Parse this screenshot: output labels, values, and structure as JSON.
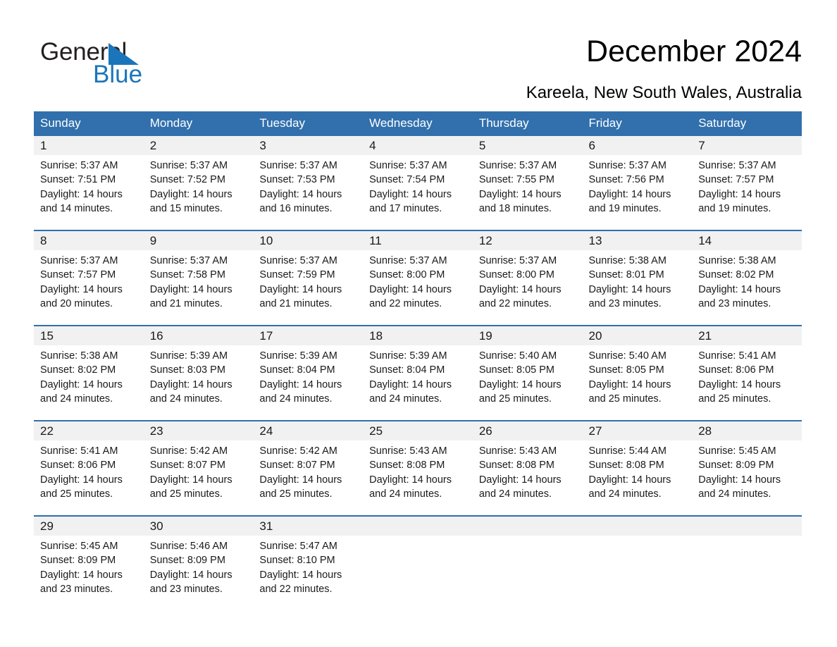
{
  "brand": {
    "name_part1": "General",
    "name_part2": "Blue",
    "triangle_color": "#1b75bb",
    "text_color": "#231f20"
  },
  "header": {
    "title": "December 2024",
    "subtitle": "Kareela, New South Wales, Australia",
    "header_bg": "#3170ad",
    "daynum_bg": "#f1f1f1"
  },
  "weekdays": [
    "Sunday",
    "Monday",
    "Tuesday",
    "Wednesday",
    "Thursday",
    "Friday",
    "Saturday"
  ],
  "weeks": [
    {
      "days": [
        {
          "num": "1",
          "sunrise": "Sunrise: 5:37 AM",
          "sunset": "Sunset: 7:51 PM",
          "daylight1": "Daylight: 14 hours",
          "daylight2": "and 14 minutes."
        },
        {
          "num": "2",
          "sunrise": "Sunrise: 5:37 AM",
          "sunset": "Sunset: 7:52 PM",
          "daylight1": "Daylight: 14 hours",
          "daylight2": "and 15 minutes."
        },
        {
          "num": "3",
          "sunrise": "Sunrise: 5:37 AM",
          "sunset": "Sunset: 7:53 PM",
          "daylight1": "Daylight: 14 hours",
          "daylight2": "and 16 minutes."
        },
        {
          "num": "4",
          "sunrise": "Sunrise: 5:37 AM",
          "sunset": "Sunset: 7:54 PM",
          "daylight1": "Daylight: 14 hours",
          "daylight2": "and 17 minutes."
        },
        {
          "num": "5",
          "sunrise": "Sunrise: 5:37 AM",
          "sunset": "Sunset: 7:55 PM",
          "daylight1": "Daylight: 14 hours",
          "daylight2": "and 18 minutes."
        },
        {
          "num": "6",
          "sunrise": "Sunrise: 5:37 AM",
          "sunset": "Sunset: 7:56 PM",
          "daylight1": "Daylight: 14 hours",
          "daylight2": "and 19 minutes."
        },
        {
          "num": "7",
          "sunrise": "Sunrise: 5:37 AM",
          "sunset": "Sunset: 7:57 PM",
          "daylight1": "Daylight: 14 hours",
          "daylight2": "and 19 minutes."
        }
      ]
    },
    {
      "days": [
        {
          "num": "8",
          "sunrise": "Sunrise: 5:37 AM",
          "sunset": "Sunset: 7:57 PM",
          "daylight1": "Daylight: 14 hours",
          "daylight2": "and 20 minutes."
        },
        {
          "num": "9",
          "sunrise": "Sunrise: 5:37 AM",
          "sunset": "Sunset: 7:58 PM",
          "daylight1": "Daylight: 14 hours",
          "daylight2": "and 21 minutes."
        },
        {
          "num": "10",
          "sunrise": "Sunrise: 5:37 AM",
          "sunset": "Sunset: 7:59 PM",
          "daylight1": "Daylight: 14 hours",
          "daylight2": "and 21 minutes."
        },
        {
          "num": "11",
          "sunrise": "Sunrise: 5:37 AM",
          "sunset": "Sunset: 8:00 PM",
          "daylight1": "Daylight: 14 hours",
          "daylight2": "and 22 minutes."
        },
        {
          "num": "12",
          "sunrise": "Sunrise: 5:37 AM",
          "sunset": "Sunset: 8:00 PM",
          "daylight1": "Daylight: 14 hours",
          "daylight2": "and 22 minutes."
        },
        {
          "num": "13",
          "sunrise": "Sunrise: 5:38 AM",
          "sunset": "Sunset: 8:01 PM",
          "daylight1": "Daylight: 14 hours",
          "daylight2": "and 23 minutes."
        },
        {
          "num": "14",
          "sunrise": "Sunrise: 5:38 AM",
          "sunset": "Sunset: 8:02 PM",
          "daylight1": "Daylight: 14 hours",
          "daylight2": "and 23 minutes."
        }
      ]
    },
    {
      "days": [
        {
          "num": "15",
          "sunrise": "Sunrise: 5:38 AM",
          "sunset": "Sunset: 8:02 PM",
          "daylight1": "Daylight: 14 hours",
          "daylight2": "and 24 minutes."
        },
        {
          "num": "16",
          "sunrise": "Sunrise: 5:39 AM",
          "sunset": "Sunset: 8:03 PM",
          "daylight1": "Daylight: 14 hours",
          "daylight2": "and 24 minutes."
        },
        {
          "num": "17",
          "sunrise": "Sunrise: 5:39 AM",
          "sunset": "Sunset: 8:04 PM",
          "daylight1": "Daylight: 14 hours",
          "daylight2": "and 24 minutes."
        },
        {
          "num": "18",
          "sunrise": "Sunrise: 5:39 AM",
          "sunset": "Sunset: 8:04 PM",
          "daylight1": "Daylight: 14 hours",
          "daylight2": "and 24 minutes."
        },
        {
          "num": "19",
          "sunrise": "Sunrise: 5:40 AM",
          "sunset": "Sunset: 8:05 PM",
          "daylight1": "Daylight: 14 hours",
          "daylight2": "and 25 minutes."
        },
        {
          "num": "20",
          "sunrise": "Sunrise: 5:40 AM",
          "sunset": "Sunset: 8:05 PM",
          "daylight1": "Daylight: 14 hours",
          "daylight2": "and 25 minutes."
        },
        {
          "num": "21",
          "sunrise": "Sunrise: 5:41 AM",
          "sunset": "Sunset: 8:06 PM",
          "daylight1": "Daylight: 14 hours",
          "daylight2": "and 25 minutes."
        }
      ]
    },
    {
      "days": [
        {
          "num": "22",
          "sunrise": "Sunrise: 5:41 AM",
          "sunset": "Sunset: 8:06 PM",
          "daylight1": "Daylight: 14 hours",
          "daylight2": "and 25 minutes."
        },
        {
          "num": "23",
          "sunrise": "Sunrise: 5:42 AM",
          "sunset": "Sunset: 8:07 PM",
          "daylight1": "Daylight: 14 hours",
          "daylight2": "and 25 minutes."
        },
        {
          "num": "24",
          "sunrise": "Sunrise: 5:42 AM",
          "sunset": "Sunset: 8:07 PM",
          "daylight1": "Daylight: 14 hours",
          "daylight2": "and 25 minutes."
        },
        {
          "num": "25",
          "sunrise": "Sunrise: 5:43 AM",
          "sunset": "Sunset: 8:08 PM",
          "daylight1": "Daylight: 14 hours",
          "daylight2": "and 24 minutes."
        },
        {
          "num": "26",
          "sunrise": "Sunrise: 5:43 AM",
          "sunset": "Sunset: 8:08 PM",
          "daylight1": "Daylight: 14 hours",
          "daylight2": "and 24 minutes."
        },
        {
          "num": "27",
          "sunrise": "Sunrise: 5:44 AM",
          "sunset": "Sunset: 8:08 PM",
          "daylight1": "Daylight: 14 hours",
          "daylight2": "and 24 minutes."
        },
        {
          "num": "28",
          "sunrise": "Sunrise: 5:45 AM",
          "sunset": "Sunset: 8:09 PM",
          "daylight1": "Daylight: 14 hours",
          "daylight2": "and 24 minutes."
        }
      ]
    },
    {
      "days": [
        {
          "num": "29",
          "sunrise": "Sunrise: 5:45 AM",
          "sunset": "Sunset: 8:09 PM",
          "daylight1": "Daylight: 14 hours",
          "daylight2": "and 23 minutes."
        },
        {
          "num": "30",
          "sunrise": "Sunrise: 5:46 AM",
          "sunset": "Sunset: 8:09 PM",
          "daylight1": "Daylight: 14 hours",
          "daylight2": "and 23 minutes."
        },
        {
          "num": "31",
          "sunrise": "Sunrise: 5:47 AM",
          "sunset": "Sunset: 8:10 PM",
          "daylight1": "Daylight: 14 hours",
          "daylight2": "and 22 minutes."
        },
        {
          "num": "",
          "sunrise": "",
          "sunset": "",
          "daylight1": "",
          "daylight2": ""
        },
        {
          "num": "",
          "sunrise": "",
          "sunset": "",
          "daylight1": "",
          "daylight2": ""
        },
        {
          "num": "",
          "sunrise": "",
          "sunset": "",
          "daylight1": "",
          "daylight2": ""
        },
        {
          "num": "",
          "sunrise": "",
          "sunset": "",
          "daylight1": "",
          "daylight2": ""
        }
      ]
    }
  ]
}
